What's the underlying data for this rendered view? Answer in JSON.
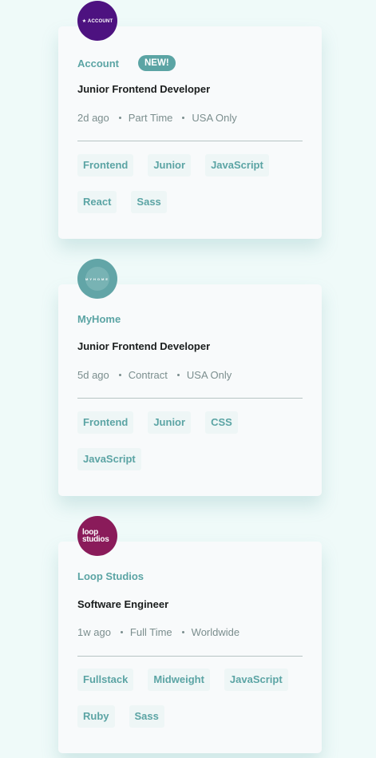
{
  "jobs": [
    {
      "logo_text": "★ ACCOUNT",
      "company": "Account",
      "new_badge": "NEW!",
      "position": "Junior Frontend Developer",
      "posted": "2d ago",
      "contract": "Part Time",
      "location": "USA Only",
      "tags": [
        "Frontend",
        "Junior",
        "JavaScript",
        "React",
        "Sass"
      ]
    },
    {
      "logo_text": "MYHOME",
      "company": "MyHome",
      "position": "Junior Frontend Developer",
      "posted": "5d ago",
      "contract": "Contract",
      "location": "USA Only",
      "tags": [
        "Frontend",
        "Junior",
        "CSS",
        "JavaScript"
      ]
    },
    {
      "logo_text": "loop studios",
      "company": "Loop Studios",
      "position": "Software Engineer",
      "posted": "1w ago",
      "contract": "Full Time",
      "location": "Worldwide",
      "tags": [
        "Fullstack",
        "Midweight",
        "JavaScript",
        "Ruby",
        "Sass"
      ]
    }
  ]
}
